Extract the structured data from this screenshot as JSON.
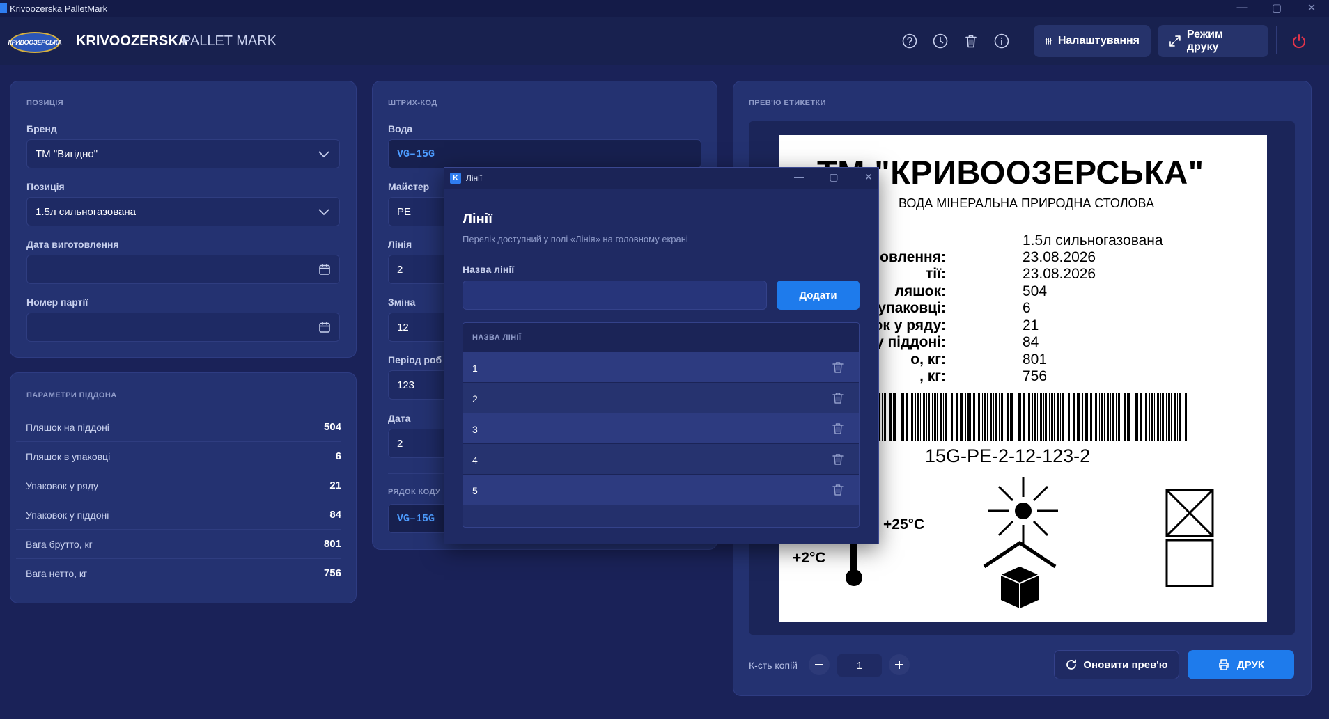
{
  "window": {
    "title": "Krivoozerska PalletMark",
    "controls": {
      "minimize": "—",
      "maximize": "▢",
      "close": "✕"
    }
  },
  "header": {
    "logo_text": "КРИВООЗЕРСЬКА",
    "brand": "KRIVOOZERSKA",
    "brand_sub": "PALLET MARK",
    "icons": [
      "help-icon",
      "history-icon",
      "trash-icon",
      "info-icon",
      "power-icon"
    ],
    "settings_label": "Налаштування",
    "print_mode_label": "Режим друку",
    "accent_power": "#e0344a"
  },
  "position_panel": {
    "title": "ПОЗИЦІЯ",
    "brand_label": "Бренд",
    "brand_value": "ТМ \"Вигідно\"",
    "position_label": "Позиція",
    "position_value": "1.5л сильногазована",
    "date_label": "Дата виготовлення",
    "date_value": "",
    "batch_label": "Номер партії",
    "batch_value": ""
  },
  "pallet_params": {
    "title": "ПАРАМЕТРИ ПІДДОНА",
    "rows": [
      {
        "label": "Пляшок на піддоні",
        "value": "504"
      },
      {
        "label": "Пляшок в упаковці",
        "value": "6"
      },
      {
        "label": "Упаковок у ряду",
        "value": "21"
      },
      {
        "label": "Упаковок у піддоні",
        "value": "84"
      },
      {
        "label": "Вага брутто, кг",
        "value": "801"
      },
      {
        "label": "Вага нетто, кг",
        "value": "756"
      }
    ]
  },
  "barcode_panel": {
    "title": "ШТРИХ-КОД",
    "water_label": "Вода",
    "water_value": "VG–15G",
    "master_label": "Майстер",
    "master_value": "PE",
    "line_label": "Лінія",
    "line_value": "2",
    "shift_label": "Зміна",
    "shift_value": "12",
    "period_label": "Період роб",
    "period_value": "123",
    "date_label": "Дата",
    "date_value": "2",
    "code_row_label": "РЯДОК КОДУ",
    "code_row_value": "VG–15G"
  },
  "preview": {
    "title": "ПРЕВ'Ю ЕТИКЕТКИ",
    "label": {
      "title": "ТМ \"КРИВООЗЕРСЬКА\"",
      "subtitle": "ВОДА МІНЕРАЛЬНА ПРИРОДНА СТОЛОВА",
      "rows": [
        {
          "key": "",
          "value": "1.5л сильногазована"
        },
        {
          "key": "овлення:",
          "value": "23.08.2026"
        },
        {
          "key": "тії:",
          "value": "23.08.2026"
        },
        {
          "key": "ляшок:",
          "value": "504"
        },
        {
          "key": "ляшок у упаковці:",
          "value": "6"
        },
        {
          "key": "паковок у ряду:",
          "value": "21"
        },
        {
          "key": "паковок у піддоні:",
          "value": "84"
        },
        {
          "key": "о, кг:",
          "value": "801"
        },
        {
          "key": ", кг:",
          "value": "756"
        }
      ],
      "barcode_text": "15G-PE-2-12-123-2",
      "temp_max": "+25°C",
      "temp_min": "+2°C"
    },
    "copies_label": "К-сть копій",
    "copies_value": "1",
    "refresh_label": "Оновити прев'ю",
    "print_label": "ДРУК"
  },
  "modal": {
    "window_title": "Лінії",
    "heading": "Лінії",
    "description": "Перелік доступний у полі «Лінія» на головному екрані",
    "field_label": "Назва лінії",
    "field_value": "",
    "add_label": "Додати",
    "table_header": "НАЗВА ЛІНІЇ",
    "rows": [
      "1",
      "2",
      "3",
      "4",
      "5"
    ]
  },
  "colors": {
    "background": "#1a2258",
    "panel": "#243271",
    "accent": "#1e7bec",
    "mono_text": "#4d9cff"
  }
}
